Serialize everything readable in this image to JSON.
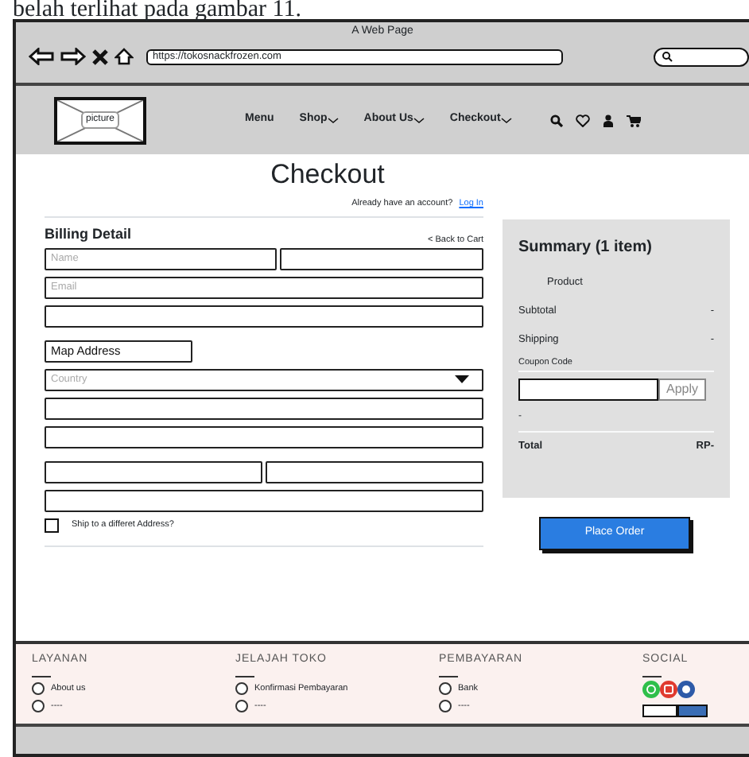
{
  "doc_caption": "belah terlihat pada gambar 11.",
  "window": {
    "title": "A Web Page",
    "url": "https://tokosnackfrozen.com"
  },
  "header": {
    "logo_label": "picture",
    "nav": [
      {
        "label": "Menu",
        "dropdown": false
      },
      {
        "label": "Shop",
        "dropdown": true
      },
      {
        "label": "About Us",
        "dropdown": true
      },
      {
        "label": "Checkout",
        "dropdown": true
      }
    ]
  },
  "page": {
    "title": "Checkout",
    "account_prompt": "Already have an account?",
    "login_link": "Log In",
    "billing_title": "Billing Detail",
    "back_link": "< Back to Cart",
    "field_rows": [
      [
        {
          "kind": "text",
          "placeholder": "Name"
        },
        {
          "kind": "text"
        }
      ],
      [
        {
          "kind": "text",
          "placeholder": "Email"
        }
      ],
      [
        {
          "kind": "text"
        }
      ],
      [
        {
          "kind": "label",
          "text": "Map Address"
        }
      ],
      [
        {
          "kind": "select",
          "placeholder": "Country"
        }
      ],
      [
        {
          "kind": "text"
        }
      ],
      [
        {
          "kind": "text"
        }
      ],
      [
        {
          "kind": "text"
        },
        {
          "kind": "text"
        }
      ],
      [
        {
          "kind": "text"
        }
      ]
    ],
    "ship_checkbox": {
      "label": "Ship to a differet Address?",
      "checked": false
    }
  },
  "summary": {
    "title": "Summary (1 item)",
    "product_label": "Product",
    "rows": [
      {
        "label": "Subtotal",
        "value": "-"
      },
      {
        "label": "Shipping",
        "value": "-"
      }
    ],
    "coupon_label": "Coupon Code",
    "apply_label": "Apply",
    "discount": "-",
    "total_label": "Total",
    "total_value": "RP-"
  },
  "place_order": "Place Order",
  "footer": {
    "columns": [
      {
        "heading": "LAYANAN",
        "items": [
          {
            "label": "About us",
            "selected": false
          },
          {
            "label": "----",
            "selected": false
          }
        ]
      },
      {
        "heading": "JELAJAH TOKO",
        "items": [
          {
            "label": "Konfirmasi Pembayaran",
            "selected": false
          },
          {
            "label": "----",
            "selected": false
          }
        ]
      },
      {
        "heading": "PEMBAYARAN",
        "items": [
          {
            "label": "Bank",
            "selected": false
          },
          {
            "label": "----",
            "selected": false
          }
        ]
      }
    ],
    "social_heading": "SOCIAL"
  }
}
